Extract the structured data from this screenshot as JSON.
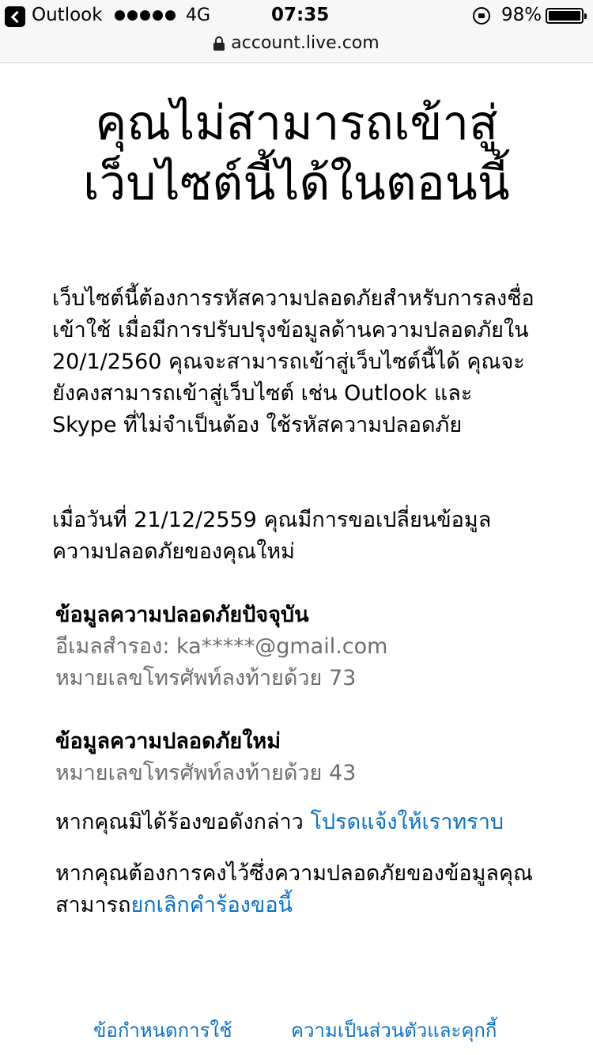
{
  "status_bar": {
    "app": "Outlook",
    "network": "4G",
    "time": "07:35",
    "battery": "98%"
  },
  "url_bar": {
    "url": "account.live.com"
  },
  "title": "คุณไม่สามารถเข้าสู่เว็บไซต์นี้ได้ในตอนนี้",
  "paragraph_1": "เว็บไซต์นี้ต้องการรหัสความปลอดภัยสำหรับการลงชื่อเข้าใช้ เมื่อมีการปรับปรุงข้อมูลด้านความปลอดภัยใน 20/1/2560 คุณจะสามารถเข้าสู่เว็บไซต์นี้ได้ คุณจะยังคงสามารถเข้าสู่เว็บไซต์ เช่น Outlook และ Skype ที่ไม่จำเป็นต้อง ใช้รหัสความปลอดภัย",
  "paragraph_2": "เมื่อวันที่ 21/12/2559 คุณมีการขอเปลี่ยนข้อมูลความปลอดภัยของคุณใหม่",
  "current_info": {
    "heading": "ข้อมูลความปลอดภัยปัจจุบัน",
    "email": "อีเมลสำรอง: ka*****@gmail.com",
    "phone": "หมายเลขโทรศัพท์ลงท้ายด้วย 73"
  },
  "new_info": {
    "heading": "ข้อมูลความปลอดภัยใหม่",
    "phone": "หมายเลขโทรศัพท์ลงท้ายด้วย 43"
  },
  "not_requested": {
    "text": "หากคุณมิได้ร้องขอดังกล่าว",
    "link": "โปรดแจ้งให้เราทราบ"
  },
  "keep_info": {
    "text": "หากคุณต้องการคงไว้ซึ่งความปลอดภัยของข้อมูลคุณสามารถ",
    "link": "ยกเลิกคำร้องขอนี้"
  },
  "footer": {
    "terms": "ข้อกำหนดการใช้",
    "privacy": "ความเป็นส่วนตัวและคุกกี้"
  },
  "colors": {
    "link": "#0b72c7",
    "muted": "#6e6e6e"
  }
}
